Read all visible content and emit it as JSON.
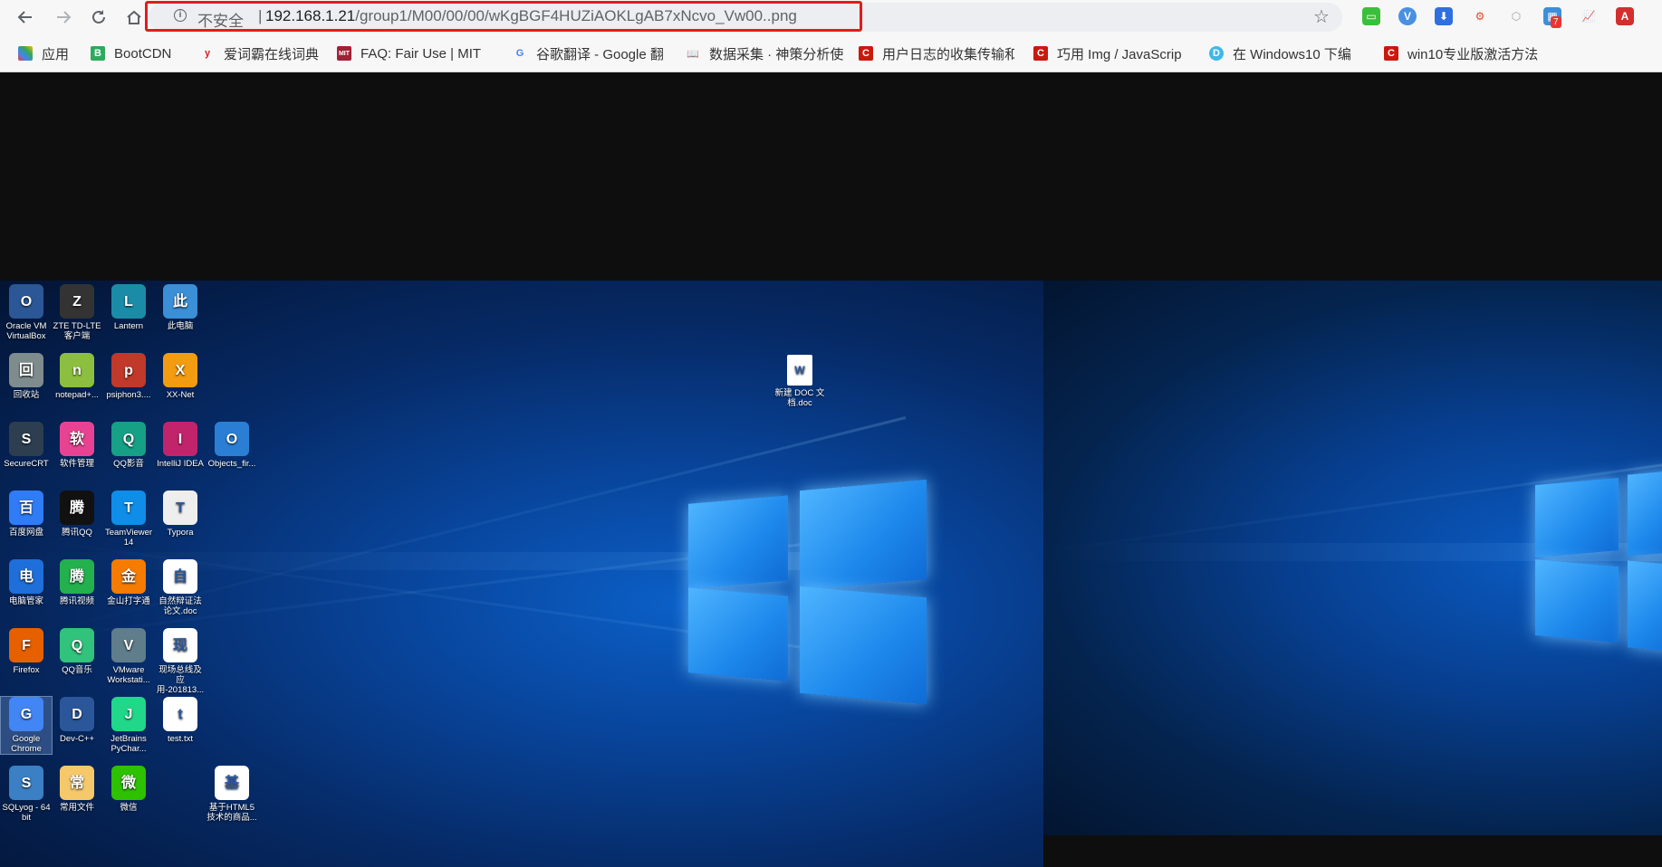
{
  "browser": {
    "nav": {
      "back": "back",
      "forward": "forward",
      "reload": "reload",
      "home": "home"
    },
    "address": {
      "security_label": "不安全",
      "separator": "|",
      "host": "192.168.1.21",
      "path": "/group1/M00/00/00/wKgBGF4HUZiAOKLgAB7xNcvo_Vw00..png"
    },
    "extensions_badge": "7"
  },
  "bookmarks": [
    {
      "label": "应用",
      "icon": "apps-grid-icon",
      "color": "#e8453c"
    },
    {
      "label": "BootCDN",
      "icon": "bootcdn-icon",
      "color": "#2eaa5e"
    },
    {
      "label": "爱词霸在线词典",
      "icon": "iciba-icon",
      "color": "#d6202a"
    },
    {
      "label": "FAQ: Fair Use | MIT",
      "icon": "mit-ocw-icon",
      "color": "#a31f34"
    },
    {
      "label": "谷歌翻译 - Google 翻",
      "icon": "google-icon",
      "color": "#4285f4"
    },
    {
      "label": "数据采集 · 神策分析使",
      "icon": "book-icon",
      "color": "#444444"
    },
    {
      "label": "用户日志的收集传输和",
      "icon": "csdn-icon",
      "color": "#c9190e"
    },
    {
      "label": "巧用 Img / JavaScrip",
      "icon": "csdn-icon",
      "color": "#c9190e"
    },
    {
      "label": "在 Windows10 下编",
      "icon": "d-icon",
      "color": "#3fb8e8"
    },
    {
      "label": "win10专业版激活方法",
      "icon": "csdn-icon",
      "color": "#c9190e"
    }
  ],
  "desktop": {
    "icons": [
      {
        "label": "Oracle VM VirtualBox",
        "icon": "virtualbox-icon",
        "color": "#2b5797"
      },
      {
        "label": "ZTE TD-LTE 客户端",
        "icon": "zte-lte-icon",
        "color": "#333333"
      },
      {
        "label": "Lantern",
        "icon": "lantern-icon",
        "color": "#1b8ca8"
      },
      {
        "label": "此电脑",
        "icon": "this-pc-icon",
        "color": "#3a8fd6"
      },
      {
        "label": "回收站",
        "icon": "recycle-bin-icon",
        "color": "#7f8c8d"
      },
      {
        "label": "notepad+...",
        "icon": "notepad-plus-icon",
        "color": "#8cbf3f"
      },
      {
        "label": "psiphon3....",
        "icon": "psiphon-icon",
        "color": "#c0392b"
      },
      {
        "label": "XX-Net",
        "icon": "xx-net-icon",
        "color": "#f39c12"
      },
      {
        "label": "SecureCRT",
        "icon": "securecrt-icon",
        "color": "#2c3e50"
      },
      {
        "label": "软件管理",
        "icon": "software-manager-icon",
        "color": "#e84393"
      },
      {
        "label": "QQ影音",
        "icon": "qq-player-icon",
        "color": "#16a085"
      },
      {
        "label": "IntelliJ IDEA",
        "icon": "intellij-icon",
        "color": "#c1246b"
      },
      {
        "label": "Objects_fir...",
        "icon": "pdf-icon",
        "color": "#2a7fd4"
      },
      {
        "label": "百度网盘",
        "icon": "baidu-netdisk-icon",
        "color": "#2f7cf6"
      },
      {
        "label": "腾讯QQ",
        "icon": "qq-icon",
        "color": "#111111"
      },
      {
        "label": "TeamViewer 14",
        "icon": "teamviewer-icon",
        "color": "#0e8ee9"
      },
      {
        "label": "Typora",
        "icon": "typora-icon",
        "color": "#eeeeee"
      },
      {
        "label": "电脑管家",
        "icon": "pc-manager-icon",
        "color": "#1e6fd9"
      },
      {
        "label": "腾讯视频",
        "icon": "tencent-video-icon",
        "color": "#23b14d"
      },
      {
        "label": "金山打字通",
        "icon": "typing-icon",
        "color": "#f57c00"
      },
      {
        "label": "自然辩证法论文.doc",
        "icon": "word-doc-icon",
        "color": "#ffffff"
      },
      {
        "label": "Firefox",
        "icon": "firefox-icon",
        "color": "#e66000"
      },
      {
        "label": "QQ音乐",
        "icon": "qq-music-icon",
        "color": "#31c27c"
      },
      {
        "label": "VMware Workstati...",
        "icon": "vmware-icon",
        "color": "#607d8b"
      },
      {
        "label": "现场总线及应用-201813...",
        "icon": "word-doc-icon",
        "color": "#ffffff"
      },
      {
        "label": "Google Chrome",
        "icon": "chrome-icon",
        "color": "#4285f4"
      },
      {
        "label": "Dev-C++",
        "icon": "devcpp-icon",
        "color": "#2b579a"
      },
      {
        "label": "JetBrains PyChar...",
        "icon": "pycharm-icon",
        "color": "#21d789"
      },
      {
        "label": "test.txt",
        "icon": "text-file-icon",
        "color": "#ffffff"
      },
      {
        "label": "SQLyog - 64 bit",
        "icon": "sqlyog-icon",
        "color": "#3b7fc4"
      },
      {
        "label": "常用文件",
        "icon": "folder-icon",
        "color": "#f5c86a"
      },
      {
        "label": "微信",
        "icon": "wechat-icon",
        "color": "#2dc100"
      },
      {
        "label": "基于HTML5技术的商品...",
        "icon": "word-doc-icon",
        "color": "#ffffff"
      }
    ],
    "center_file": {
      "label": "新建 DOC 文档.doc",
      "icon": "word-doc-icon"
    }
  }
}
